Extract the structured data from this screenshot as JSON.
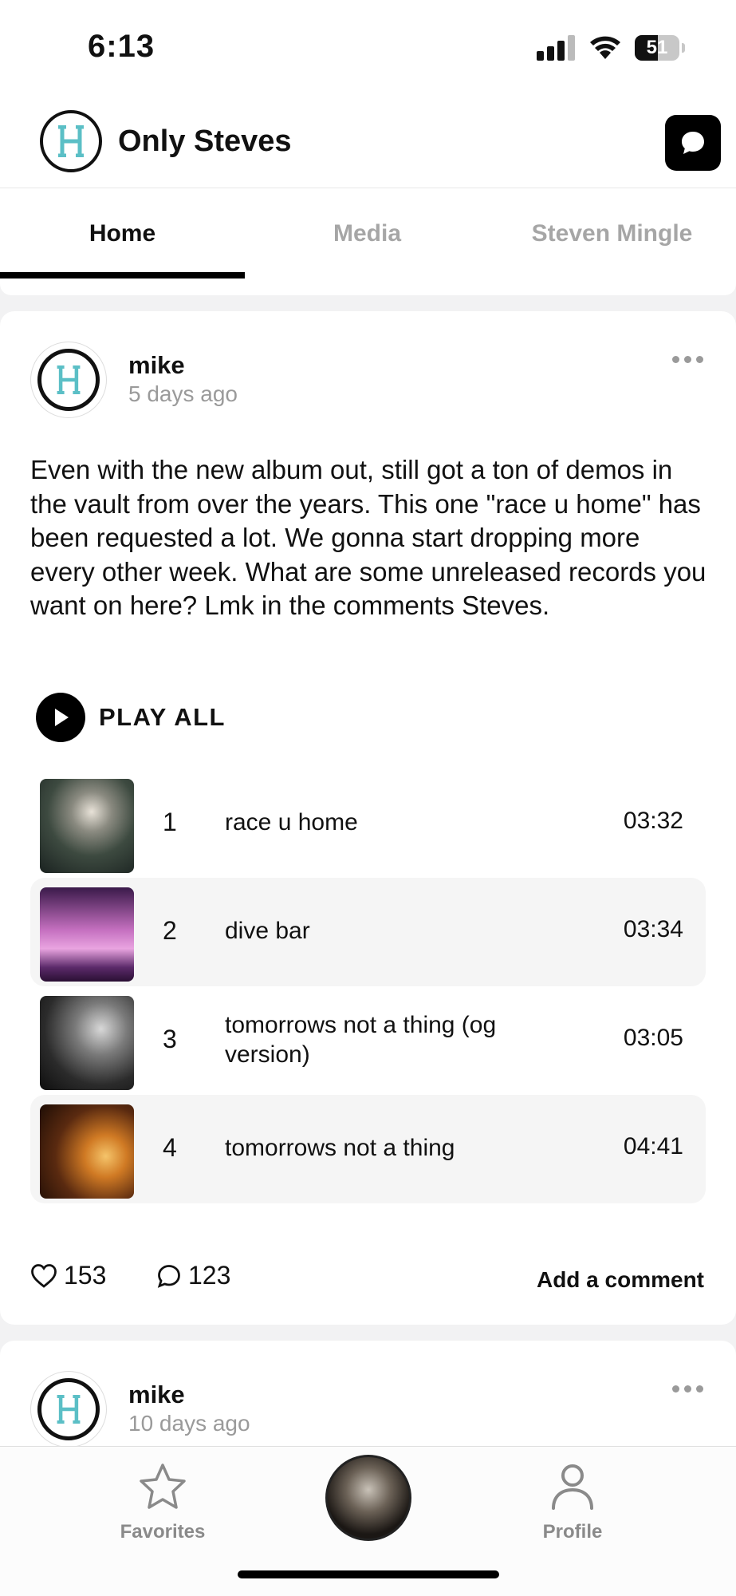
{
  "status_bar": {
    "time": "6:13",
    "battery": "51",
    "battery_level": 0.51
  },
  "header": {
    "title": "Only Steves",
    "logo_letter": "H"
  },
  "tabs": [
    {
      "label": "Home",
      "active": true
    },
    {
      "label": "Media",
      "active": false
    },
    {
      "label": "Steven Mingle",
      "active": false
    }
  ],
  "post": {
    "author": "mike",
    "time": "5 days ago",
    "text": "Even with the new album out, still got a ton of demos in the vault from over the years. This one \"race u home\" has been requested a lot. We gonna start dropping more every other week. What are some unreleased records you want on here? Lmk in the comments Steves.",
    "play_all": "PLAY ALL",
    "tracks": [
      {
        "num": "1",
        "title": "race u home",
        "duration": "03:32"
      },
      {
        "num": "2",
        "title": "dive bar",
        "duration": "03:34"
      },
      {
        "num": "3",
        "title": "tomorrows not a thing (og version)",
        "duration": "03:05"
      },
      {
        "num": "4",
        "title": "tomorrows not a thing",
        "duration": "04:41"
      }
    ],
    "likes": "153",
    "comments": "123",
    "add_comment": "Add a comment"
  },
  "next_post": {
    "author": "mike",
    "time": "10 days ago"
  },
  "bottom_nav": {
    "favorites": "Favorites",
    "profile": "Profile"
  },
  "colors": {
    "accent_teal": "#5bbfc6",
    "tab_inactive": "#a6a6a6",
    "row_alt_bg": "#f5f5f5"
  }
}
